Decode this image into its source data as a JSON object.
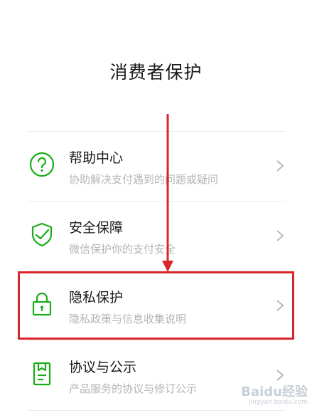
{
  "page": {
    "title": "消费者保护"
  },
  "colors": {
    "accent": "#1aad19",
    "highlight": "#d9262a",
    "arrow": "#d9262a"
  },
  "menu": {
    "items": [
      {
        "title": "帮助中心",
        "subtitle": "协助解决支付遇到的问题或疑问",
        "icon": "help-circle-icon"
      },
      {
        "title": "安全保障",
        "subtitle": "微信保护你的支付安全",
        "icon": "shield-check-icon"
      },
      {
        "title": "隐私保护",
        "subtitle": "隐私政策与信息收集说明",
        "icon": "lock-icon"
      },
      {
        "title": "协议与公示",
        "subtitle": "产品服务的协议与修订公示",
        "icon": "document-icon"
      }
    ]
  },
  "watermark": {
    "brand": "Baidu经验",
    "url": "jingyan.baidu.com"
  }
}
